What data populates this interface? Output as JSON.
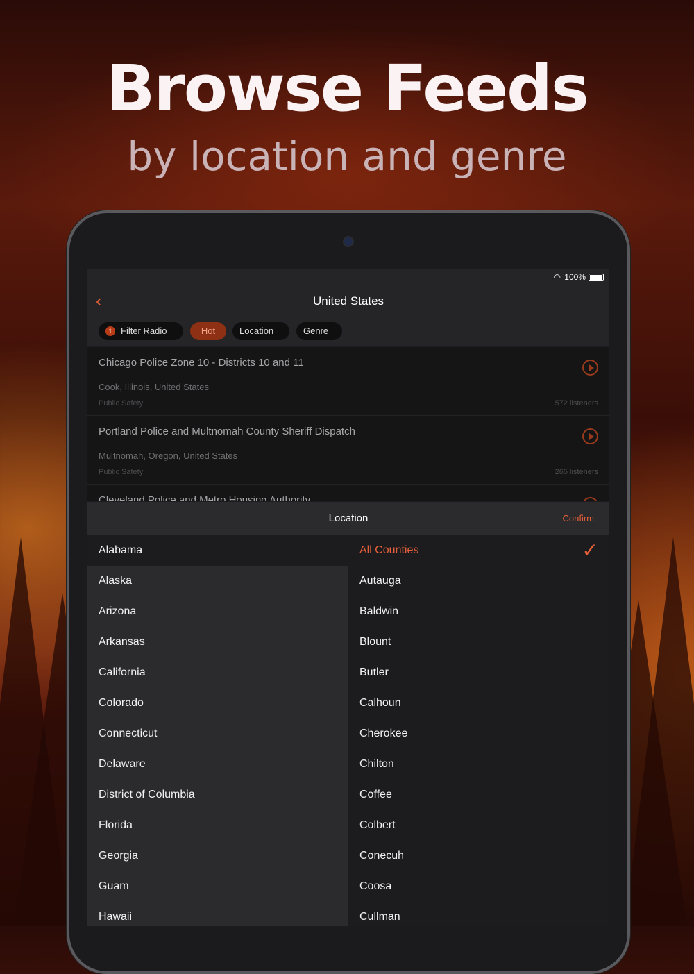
{
  "promo": {
    "headline": "Browse Feeds",
    "subheadline": "by location and genre"
  },
  "status_bar": {
    "battery": "100%"
  },
  "nav": {
    "back_icon": "chevron-left-icon",
    "title": "United States"
  },
  "filters": {
    "filter_badge": "1",
    "filter_label": "Filter Radio",
    "hot_label": "Hot",
    "location_label": "Location ⌵",
    "genre_label": "Genre ⌵"
  },
  "feeds": [
    {
      "title": "Chicago Police Zone 10 - Districts 10 and 11",
      "location": "Cook, Illinois, United States",
      "genre": "Public Safety",
      "listeners": "572 listeners"
    },
    {
      "title": "Portland Police and Multnomah County Sheriff Dispatch",
      "location": "Multnomah, Oregon, United States",
      "genre": "Public Safety",
      "listeners": "265 listeners"
    },
    {
      "title": "Cleveland Police and Metro Housing Authority"
    }
  ],
  "picker": {
    "title": "Location",
    "confirm_label": "Confirm"
  },
  "states": [
    "Alabama",
    "Alaska",
    "Arizona",
    "Arkansas",
    "California",
    "Colorado",
    "Connecticut",
    "Delaware",
    "District of Columbia",
    "Florida",
    "Georgia",
    "Guam",
    "Hawaii"
  ],
  "counties": [
    "All Counties",
    "Autauga",
    "Baldwin",
    "Blount",
    "Butler",
    "Calhoun",
    "Cherokee",
    "Chilton",
    "Coffee",
    "Colbert",
    "Conecuh",
    "Coosa",
    "Cullman"
  ],
  "colors": {
    "accent": "#e8603a",
    "hot_chip": "#8e3014"
  }
}
